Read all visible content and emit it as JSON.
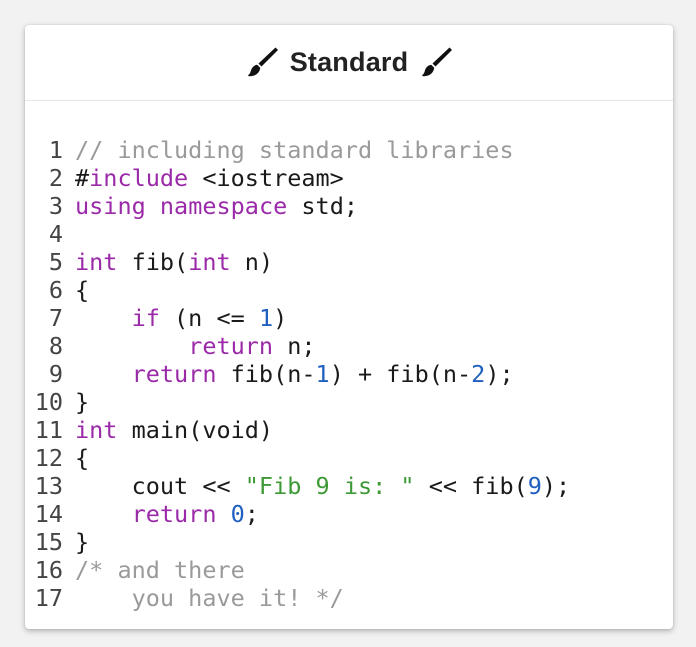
{
  "header": {
    "title": "Standard",
    "left_icon": "paintbrush-icon",
    "right_icon": "paintbrush-icon",
    "icon_color": "#111111"
  },
  "colors": {
    "keyword": "#9a2aa8",
    "number": "#1f5fbf",
    "string": "#3d9a36",
    "comment": "#9a9a9a",
    "text": "#1a1a1a"
  },
  "code": {
    "lines": [
      {
        "num": "1",
        "tokens": [
          {
            "t": "// including standard libraries",
            "c": "c"
          }
        ]
      },
      {
        "num": "2",
        "tokens": [
          {
            "t": "#",
            "c": "p"
          },
          {
            "t": "include",
            "c": "k"
          },
          {
            "t": " <iostream>",
            "c": "p"
          }
        ]
      },
      {
        "num": "3",
        "tokens": [
          {
            "t": "using",
            "c": "k"
          },
          {
            "t": " ",
            "c": "p"
          },
          {
            "t": "namespace",
            "c": "k"
          },
          {
            "t": " std;",
            "c": "p"
          }
        ]
      },
      {
        "num": "4",
        "tokens": []
      },
      {
        "num": "5",
        "tokens": [
          {
            "t": "int",
            "c": "k"
          },
          {
            "t": " fib(",
            "c": "p"
          },
          {
            "t": "int",
            "c": "k"
          },
          {
            "t": " n)",
            "c": "p"
          }
        ]
      },
      {
        "num": "6",
        "tokens": [
          {
            "t": "{",
            "c": "p"
          }
        ]
      },
      {
        "num": "7",
        "tokens": [
          {
            "t": "    ",
            "c": "p"
          },
          {
            "t": "if",
            "c": "k"
          },
          {
            "t": " (n <= ",
            "c": "p"
          },
          {
            "t": "1",
            "c": "n"
          },
          {
            "t": ")",
            "c": "p"
          }
        ]
      },
      {
        "num": "8",
        "tokens": [
          {
            "t": "        ",
            "c": "p"
          },
          {
            "t": "return",
            "c": "k"
          },
          {
            "t": " n;",
            "c": "p"
          }
        ]
      },
      {
        "num": "9",
        "tokens": [
          {
            "t": "    ",
            "c": "p"
          },
          {
            "t": "return",
            "c": "k"
          },
          {
            "t": " fib(n-",
            "c": "p"
          },
          {
            "t": "1",
            "c": "n"
          },
          {
            "t": ") + fib(n-",
            "c": "p"
          },
          {
            "t": "2",
            "c": "n"
          },
          {
            "t": ");",
            "c": "p"
          }
        ]
      },
      {
        "num": "10",
        "tokens": [
          {
            "t": "}",
            "c": "p"
          }
        ]
      },
      {
        "num": "11",
        "tokens": [
          {
            "t": "int",
            "c": "k"
          },
          {
            "t": " main(void)",
            "c": "p"
          }
        ]
      },
      {
        "num": "12",
        "tokens": [
          {
            "t": "{",
            "c": "p"
          }
        ]
      },
      {
        "num": "13",
        "tokens": [
          {
            "t": "    cout << ",
            "c": "p"
          },
          {
            "t": "\"Fib 9 is: \"",
            "c": "s"
          },
          {
            "t": " << fib(",
            "c": "p"
          },
          {
            "t": "9",
            "c": "n"
          },
          {
            "t": ");",
            "c": "p"
          }
        ]
      },
      {
        "num": "14",
        "tokens": [
          {
            "t": "    ",
            "c": "p"
          },
          {
            "t": "return",
            "c": "k"
          },
          {
            "t": " ",
            "c": "p"
          },
          {
            "t": "0",
            "c": "n"
          },
          {
            "t": ";",
            "c": "p"
          }
        ]
      },
      {
        "num": "15",
        "tokens": [
          {
            "t": "}",
            "c": "p"
          }
        ]
      },
      {
        "num": "16",
        "tokens": [
          {
            "t": "/* and there",
            "c": "c"
          }
        ]
      },
      {
        "num": "17",
        "tokens": [
          {
            "t": "    you have it! */",
            "c": "c"
          }
        ]
      }
    ]
  }
}
